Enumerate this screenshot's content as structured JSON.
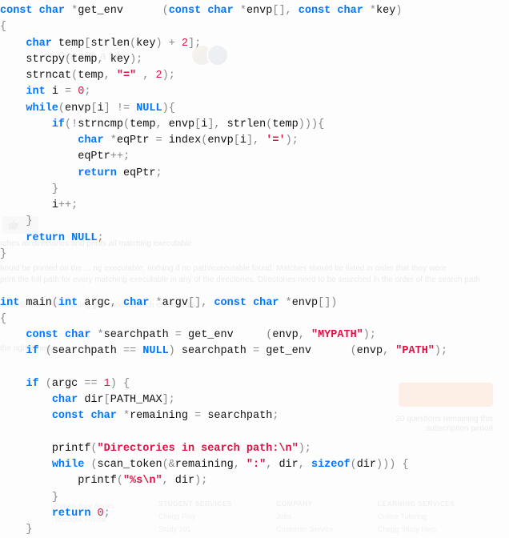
{
  "code_lines": [
    [
      [
        "kw",
        "const"
      ],
      [
        "plain",
        " "
      ],
      [
        "kw",
        "char"
      ],
      [
        "plain",
        " "
      ],
      [
        "op",
        "*"
      ],
      [
        "func",
        "get_env"
      ],
      [
        "plain",
        "      "
      ],
      [
        "paren",
        "("
      ],
      [
        "kw",
        "const"
      ],
      [
        "plain",
        " "
      ],
      [
        "kw",
        "char"
      ],
      [
        "plain",
        " "
      ],
      [
        "op",
        "*"
      ],
      [
        "ident",
        "envp"
      ],
      [
        "paren",
        "[]"
      ],
      [
        "op",
        ","
      ],
      [
        "plain",
        " "
      ],
      [
        "kw",
        "const"
      ],
      [
        "plain",
        " "
      ],
      [
        "kw",
        "char"
      ],
      [
        "plain",
        " "
      ],
      [
        "op",
        "*"
      ],
      [
        "ident",
        "key"
      ],
      [
        "paren",
        ")"
      ]
    ],
    [
      [
        "paren",
        "{"
      ]
    ],
    [
      [
        "plain",
        "    "
      ],
      [
        "kw",
        "char"
      ],
      [
        "plain",
        " "
      ],
      [
        "ident",
        "temp"
      ],
      [
        "paren",
        "["
      ],
      [
        "func",
        "strlen"
      ],
      [
        "paren",
        "("
      ],
      [
        "ident",
        "key"
      ],
      [
        "paren",
        ")"
      ],
      [
        "plain",
        " "
      ],
      [
        "op",
        "+"
      ],
      [
        "plain",
        " "
      ],
      [
        "num",
        "2"
      ],
      [
        "paren",
        "]"
      ],
      [
        "op",
        ";"
      ]
    ],
    [
      [
        "plain",
        "    "
      ],
      [
        "func",
        "strcpy"
      ],
      [
        "paren",
        "("
      ],
      [
        "ident",
        "temp"
      ],
      [
        "op",
        ","
      ],
      [
        "plain",
        " "
      ],
      [
        "ident",
        "key"
      ],
      [
        "paren",
        ")"
      ],
      [
        "op",
        ";"
      ]
    ],
    [
      [
        "plain",
        "    "
      ],
      [
        "func",
        "strncat"
      ],
      [
        "paren",
        "("
      ],
      [
        "ident",
        "temp"
      ],
      [
        "op",
        ","
      ],
      [
        "plain",
        " "
      ],
      [
        "str",
        "\"=\""
      ],
      [
        "plain",
        " "
      ],
      [
        "op",
        ","
      ],
      [
        "plain",
        " "
      ],
      [
        "num",
        "2"
      ],
      [
        "paren",
        ")"
      ],
      [
        "op",
        ";"
      ]
    ],
    [
      [
        "plain",
        "    "
      ],
      [
        "kw",
        "int"
      ],
      [
        "plain",
        " "
      ],
      [
        "ident",
        "i"
      ],
      [
        "plain",
        " "
      ],
      [
        "op",
        "="
      ],
      [
        "plain",
        " "
      ],
      [
        "num",
        "0"
      ],
      [
        "op",
        ";"
      ]
    ],
    [
      [
        "plain",
        "    "
      ],
      [
        "kw",
        "while"
      ],
      [
        "paren",
        "("
      ],
      [
        "ident",
        "envp"
      ],
      [
        "paren",
        "["
      ],
      [
        "ident",
        "i"
      ],
      [
        "paren",
        "]"
      ],
      [
        "plain",
        " "
      ],
      [
        "op",
        "!="
      ],
      [
        "plain",
        " "
      ],
      [
        "null",
        "NULL"
      ],
      [
        "paren",
        ")"
      ],
      [
        "paren",
        "{"
      ]
    ],
    [
      [
        "plain",
        "        "
      ],
      [
        "kw",
        "if"
      ],
      [
        "paren",
        "("
      ],
      [
        "op",
        "!"
      ],
      [
        "func",
        "strncmp"
      ],
      [
        "paren",
        "("
      ],
      [
        "ident",
        "temp"
      ],
      [
        "op",
        ","
      ],
      [
        "plain",
        " "
      ],
      [
        "ident",
        "envp"
      ],
      [
        "paren",
        "["
      ],
      [
        "ident",
        "i"
      ],
      [
        "paren",
        "]"
      ],
      [
        "op",
        ","
      ],
      [
        "plain",
        " "
      ],
      [
        "func",
        "strlen"
      ],
      [
        "paren",
        "("
      ],
      [
        "ident",
        "temp"
      ],
      [
        "paren",
        "))"
      ],
      [
        "paren",
        ")"
      ],
      [
        "paren",
        "{"
      ]
    ],
    [
      [
        "plain",
        "            "
      ],
      [
        "kw",
        "char"
      ],
      [
        "plain",
        " "
      ],
      [
        "op",
        "*"
      ],
      [
        "ident",
        "eqPtr"
      ],
      [
        "plain",
        " "
      ],
      [
        "op",
        "="
      ],
      [
        "plain",
        " "
      ],
      [
        "func",
        "index"
      ],
      [
        "paren",
        "("
      ],
      [
        "ident",
        "envp"
      ],
      [
        "paren",
        "["
      ],
      [
        "ident",
        "i"
      ],
      [
        "paren",
        "]"
      ],
      [
        "op",
        ","
      ],
      [
        "plain",
        " "
      ],
      [
        "str",
        "'='"
      ],
      [
        "paren",
        ")"
      ],
      [
        "op",
        ";"
      ]
    ],
    [
      [
        "plain",
        "            "
      ],
      [
        "ident",
        "eqPtr"
      ],
      [
        "op",
        "++"
      ],
      [
        "op",
        ";"
      ]
    ],
    [
      [
        "plain",
        "            "
      ],
      [
        "kw",
        "return"
      ],
      [
        "plain",
        " "
      ],
      [
        "ident",
        "eqPtr"
      ],
      [
        "op",
        ";"
      ]
    ],
    [
      [
        "plain",
        "        "
      ],
      [
        "paren",
        "}"
      ]
    ],
    [
      [
        "plain",
        "        "
      ],
      [
        "ident",
        "i"
      ],
      [
        "op",
        "++"
      ],
      [
        "op",
        ";"
      ]
    ],
    [
      [
        "plain",
        "    "
      ],
      [
        "paren",
        "}"
      ]
    ],
    [
      [
        "plain",
        "    "
      ],
      [
        "kw",
        "return"
      ],
      [
        "plain",
        " "
      ],
      [
        "null",
        "NULL"
      ],
      [
        "op",
        ";"
      ]
    ],
    [
      [
        "paren",
        "}"
      ]
    ],
    [],
    [],
    [
      [
        "kw",
        "int"
      ],
      [
        "plain",
        " "
      ],
      [
        "func",
        "main"
      ],
      [
        "paren",
        "("
      ],
      [
        "kw",
        "int"
      ],
      [
        "plain",
        " "
      ],
      [
        "ident",
        "argc"
      ],
      [
        "op",
        ","
      ],
      [
        "plain",
        " "
      ],
      [
        "kw",
        "char"
      ],
      [
        "plain",
        " "
      ],
      [
        "op",
        "*"
      ],
      [
        "ident",
        "argv"
      ],
      [
        "paren",
        "[]"
      ],
      [
        "op",
        ","
      ],
      [
        "plain",
        " "
      ],
      [
        "kw",
        "const"
      ],
      [
        "plain",
        " "
      ],
      [
        "kw",
        "char"
      ],
      [
        "plain",
        " "
      ],
      [
        "op",
        "*"
      ],
      [
        "ident",
        "envp"
      ],
      [
        "paren",
        "[]"
      ],
      [
        "paren",
        ")"
      ]
    ],
    [
      [
        "paren",
        "{"
      ]
    ],
    [
      [
        "plain",
        "    "
      ],
      [
        "kw",
        "const"
      ],
      [
        "plain",
        " "
      ],
      [
        "kw",
        "char"
      ],
      [
        "plain",
        " "
      ],
      [
        "op",
        "*"
      ],
      [
        "ident",
        "searchpath"
      ],
      [
        "plain",
        " "
      ],
      [
        "op",
        "="
      ],
      [
        "plain",
        " "
      ],
      [
        "func",
        "get_env"
      ],
      [
        "plain",
        "     "
      ],
      [
        "paren",
        "("
      ],
      [
        "ident",
        "envp"
      ],
      [
        "op",
        ","
      ],
      [
        "plain",
        " "
      ],
      [
        "str",
        "\"MYPATH\""
      ],
      [
        "paren",
        ")"
      ],
      [
        "op",
        ";"
      ]
    ],
    [
      [
        "plain",
        "    "
      ],
      [
        "kw",
        "if"
      ],
      [
        "plain",
        " "
      ],
      [
        "paren",
        "("
      ],
      [
        "ident",
        "searchpath"
      ],
      [
        "plain",
        " "
      ],
      [
        "op",
        "=="
      ],
      [
        "plain",
        " "
      ],
      [
        "null",
        "NULL"
      ],
      [
        "paren",
        ")"
      ],
      [
        "plain",
        " "
      ],
      [
        "ident",
        "searchpath"
      ],
      [
        "plain",
        " "
      ],
      [
        "op",
        "="
      ],
      [
        "plain",
        " "
      ],
      [
        "func",
        "get_env"
      ],
      [
        "plain",
        "      "
      ],
      [
        "paren",
        "("
      ],
      [
        "ident",
        "envp"
      ],
      [
        "op",
        ","
      ],
      [
        "plain",
        " "
      ],
      [
        "str",
        "\"PATH\""
      ],
      [
        "paren",
        ")"
      ],
      [
        "op",
        ";"
      ]
    ],
    [],
    [
      [
        "plain",
        "    "
      ],
      [
        "kw",
        "if"
      ],
      [
        "plain",
        " "
      ],
      [
        "paren",
        "("
      ],
      [
        "ident",
        "argc"
      ],
      [
        "plain",
        " "
      ],
      [
        "op",
        "=="
      ],
      [
        "plain",
        " "
      ],
      [
        "num",
        "1"
      ],
      [
        "paren",
        ")"
      ],
      [
        "plain",
        " "
      ],
      [
        "paren",
        "{"
      ]
    ],
    [
      [
        "plain",
        "        "
      ],
      [
        "kw",
        "char"
      ],
      [
        "plain",
        " "
      ],
      [
        "ident",
        "dir"
      ],
      [
        "paren",
        "["
      ],
      [
        "ident",
        "PATH_MAX"
      ],
      [
        "paren",
        "]"
      ],
      [
        "op",
        ";"
      ]
    ],
    [
      [
        "plain",
        "        "
      ],
      [
        "kw",
        "const"
      ],
      [
        "plain",
        " "
      ],
      [
        "kw",
        "char"
      ],
      [
        "plain",
        " "
      ],
      [
        "op",
        "*"
      ],
      [
        "ident",
        "remaining"
      ],
      [
        "plain",
        " "
      ],
      [
        "op",
        "="
      ],
      [
        "plain",
        " "
      ],
      [
        "ident",
        "searchpath"
      ],
      [
        "op",
        ";"
      ]
    ],
    [],
    [
      [
        "plain",
        "        "
      ],
      [
        "func",
        "printf"
      ],
      [
        "paren",
        "("
      ],
      [
        "str",
        "\"Directories in search path:\\n\""
      ],
      [
        "paren",
        ")"
      ],
      [
        "op",
        ";"
      ]
    ],
    [
      [
        "plain",
        "        "
      ],
      [
        "kw",
        "while"
      ],
      [
        "plain",
        " "
      ],
      [
        "paren",
        "("
      ],
      [
        "func",
        "scan_token"
      ],
      [
        "paren",
        "("
      ],
      [
        "op",
        "&"
      ],
      [
        "ident",
        "remaining"
      ],
      [
        "op",
        ","
      ],
      [
        "plain",
        " "
      ],
      [
        "str",
        "\":\""
      ],
      [
        "op",
        ","
      ],
      [
        "plain",
        " "
      ],
      [
        "ident",
        "dir"
      ],
      [
        "op",
        ","
      ],
      [
        "plain",
        " "
      ],
      [
        "kw",
        "sizeof"
      ],
      [
        "paren",
        "("
      ],
      [
        "ident",
        "dir"
      ],
      [
        "paren",
        "))"
      ],
      [
        "paren",
        ")"
      ],
      [
        "plain",
        " "
      ],
      [
        "paren",
        "{"
      ]
    ],
    [
      [
        "plain",
        "            "
      ],
      [
        "func",
        "printf"
      ],
      [
        "paren",
        "("
      ],
      [
        "str",
        "\"%s\\n\""
      ],
      [
        "op",
        ","
      ],
      [
        "plain",
        " "
      ],
      [
        "ident",
        "dir"
      ],
      [
        "paren",
        ")"
      ],
      [
        "op",
        ";"
      ]
    ],
    [
      [
        "plain",
        "        "
      ],
      [
        "paren",
        "}"
      ]
    ],
    [
      [
        "plain",
        "        "
      ],
      [
        "kw",
        "return"
      ],
      [
        "plain",
        " "
      ],
      [
        "num",
        "0"
      ],
      [
        "op",
        ";"
      ]
    ],
    [
      [
        "plain",
        "    "
      ],
      [
        "paren",
        "}"
      ]
    ]
  ],
  "ghost": {
    "tutor": "or chat with a tutor",
    "line1": "rches all directories and prints all matching executable",
    "line2": "hould be printed on the ... ng executable, nothing if no path/executable found. Matches should be listed in order that they were",
    "line3": "print the full path for every matching executable in any of the directories. Directories need to be searched in the order of the search path",
    "line4": "ment to mainf, from using getenv/env/which commands",
    "line5": "the right Chegg ...",
    "remaining1": "20 questions remaining this",
    "remaining2": "subscription period",
    "footer": {
      "col1": {
        "hdr": "",
        "a": "Return Your Books",
        "b": "Textbook Rental"
      },
      "col2": {
        "hdr": "STUDENT SERVICES",
        "a": "Chegg Play",
        "b": "Study 101"
      },
      "col3": {
        "hdr": "COMPANY",
        "a": "Jobs",
        "b": "Customer Service"
      },
      "col4": {
        "hdr": "LEARNING SERVICES",
        "a": "Online Tutoring",
        "b": "Chegg Study Help"
      }
    }
  }
}
